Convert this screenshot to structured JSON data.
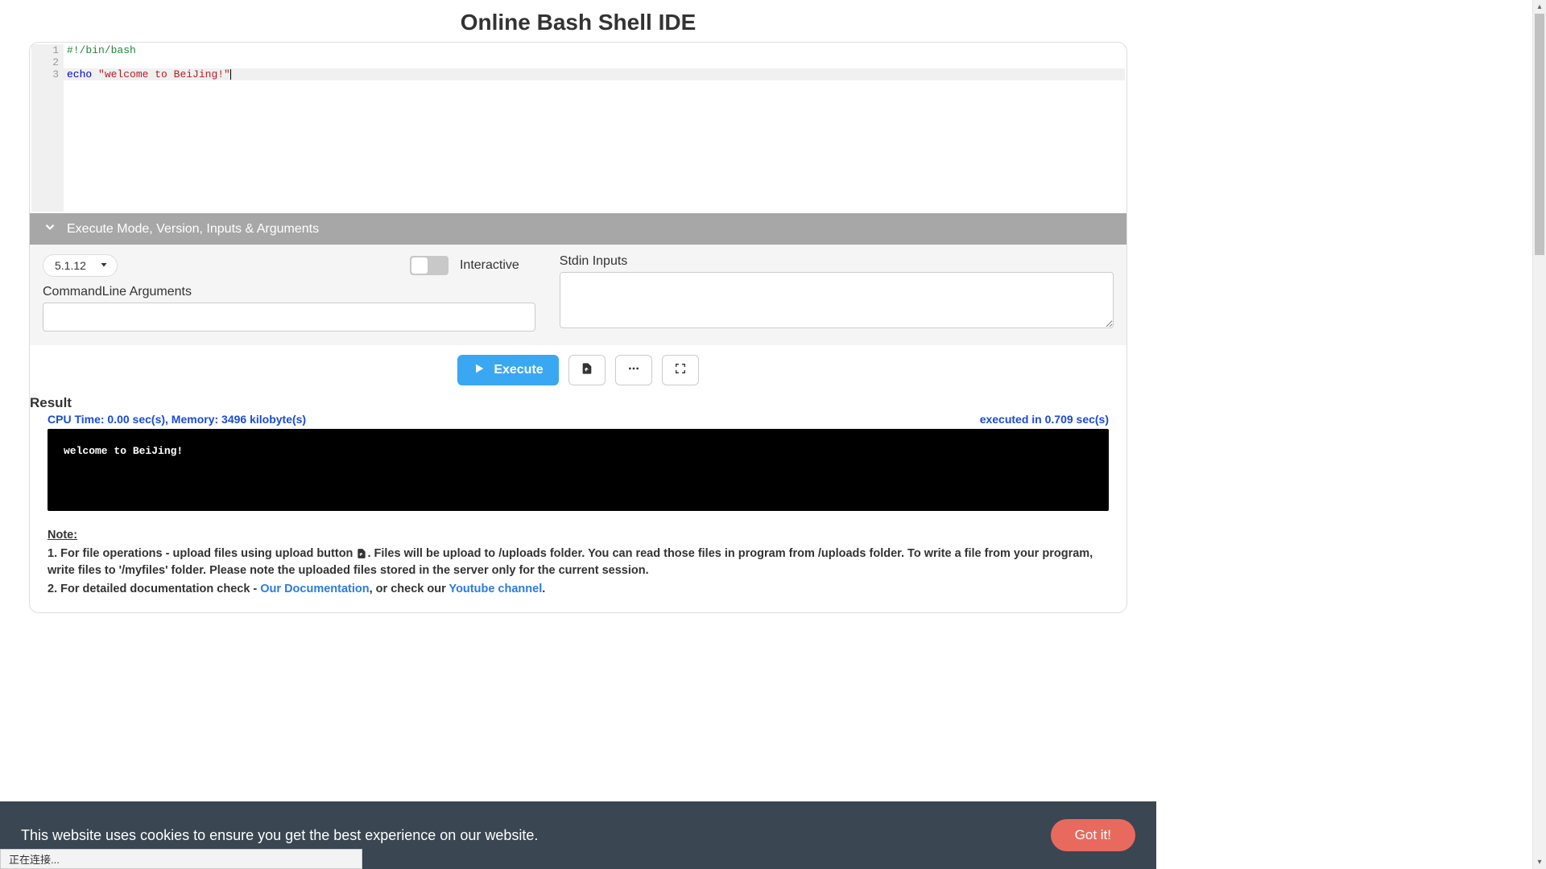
{
  "page": {
    "title": "Online Bash Shell IDE"
  },
  "editor": {
    "lines": [
      "1",
      "2",
      "3"
    ],
    "code": {
      "l1_comment": "#!/bin/bash",
      "l2": "",
      "l3_keyword": "echo",
      "l3_string": "\"welcome to BeiJing!\""
    }
  },
  "options": {
    "header": "Execute Mode, Version, Inputs & Arguments",
    "version": "5.1.12",
    "interactive_label": "Interactive",
    "cmdline_label": "CommandLine Arguments",
    "cmdline_value": "",
    "stdin_label": "Stdin Inputs",
    "stdin_value": ""
  },
  "actions": {
    "execute": "Execute"
  },
  "result": {
    "title": "Result",
    "cpu_mem": "CPU Time: 0.00 sec(s), Memory: 3496 kilobyte(s)",
    "exec_time": "executed in 0.709 sec(s)",
    "output": "welcome to BeiJing!"
  },
  "notes": {
    "title": "Note:",
    "line1a": "1. For file operations - upload files using upload button ",
    "line1b": ". Files will be upload to /uploads folder. You can read those files in program from /uploads folder. To write a file from your program, write files to '/myfiles' folder. Please note the uploaded files stored in the server only for the current session.",
    "line2a": "2. For detailed documentation check - ",
    "link_doc": "Our Documentation",
    "line2b": ", or check our ",
    "link_yt": "Youtube channel",
    "line2c": "."
  },
  "cookie": {
    "text": "This website uses cookies to ensure you get the best experience on our website.",
    "button": "Got it!"
  },
  "status": {
    "text": "正在连接..."
  }
}
